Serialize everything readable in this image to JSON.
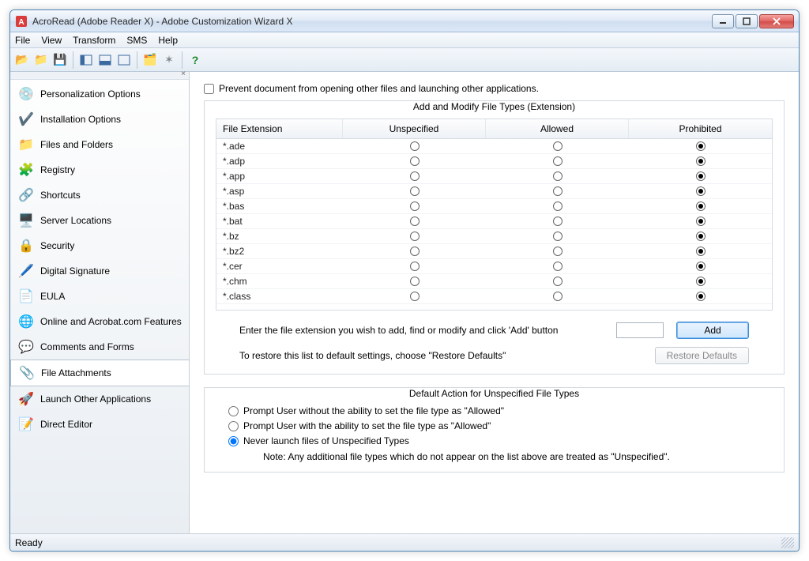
{
  "window": {
    "title": "AcroRead (Adobe Reader X) - Adobe Customization Wizard X"
  },
  "menubar": [
    "File",
    "View",
    "Transform",
    "SMS",
    "Help"
  ],
  "sidebar": {
    "items": [
      {
        "label": "Personalization Options"
      },
      {
        "label": "Installation Options"
      },
      {
        "label": "Files and Folders"
      },
      {
        "label": "Registry"
      },
      {
        "label": "Shortcuts"
      },
      {
        "label": "Server Locations"
      },
      {
        "label": "Security"
      },
      {
        "label": "Digital Signature"
      },
      {
        "label": "EULA"
      },
      {
        "label": "Online and Acrobat.com Features"
      },
      {
        "label": "Comments and Forms"
      },
      {
        "label": "File Attachments"
      },
      {
        "label": "Launch Other Applications"
      },
      {
        "label": "Direct Editor"
      }
    ],
    "selected_index": 11
  },
  "content": {
    "prevent_label": "Prevent document from opening other files and launching other applications.",
    "prevent_checked": false,
    "group1_title": "Add and Modify File Types (Extension)",
    "table": {
      "columns": [
        "File Extension",
        "Unspecified",
        "Allowed",
        "Prohibited"
      ],
      "rows": [
        {
          "ext": "*.ade",
          "state": "Prohibited"
        },
        {
          "ext": "*.adp",
          "state": "Prohibited"
        },
        {
          "ext": "*.app",
          "state": "Prohibited"
        },
        {
          "ext": "*.asp",
          "state": "Prohibited"
        },
        {
          "ext": "*.bas",
          "state": "Prohibited"
        },
        {
          "ext": "*.bat",
          "state": "Prohibited"
        },
        {
          "ext": "*.bz",
          "state": "Prohibited"
        },
        {
          "ext": "*.bz2",
          "state": "Prohibited"
        },
        {
          "ext": "*.cer",
          "state": "Prohibited"
        },
        {
          "ext": "*.chm",
          "state": "Prohibited"
        },
        {
          "ext": "*.class",
          "state": "Prohibited"
        }
      ]
    },
    "add_label": "Enter the file extension you wish to add, find or modify and click 'Add' button",
    "add_input_value": "",
    "add_button": "Add",
    "restore_label": "To restore this list to default settings, choose \"Restore Defaults\"",
    "restore_button": "Restore Defaults",
    "group2_title": "Default Action for Unspecified File Types",
    "default_actions": [
      "Prompt User without the ability to set the file type as \"Allowed\"",
      "Prompt User with the ability to set the file type as \"Allowed\"",
      "Never launch files of Unspecified Types"
    ],
    "default_selected_index": 2,
    "note": "Note: Any additional file types which do not appear on the list above are treated as \"Unspecified\"."
  },
  "statusbar": {
    "text": "Ready"
  }
}
